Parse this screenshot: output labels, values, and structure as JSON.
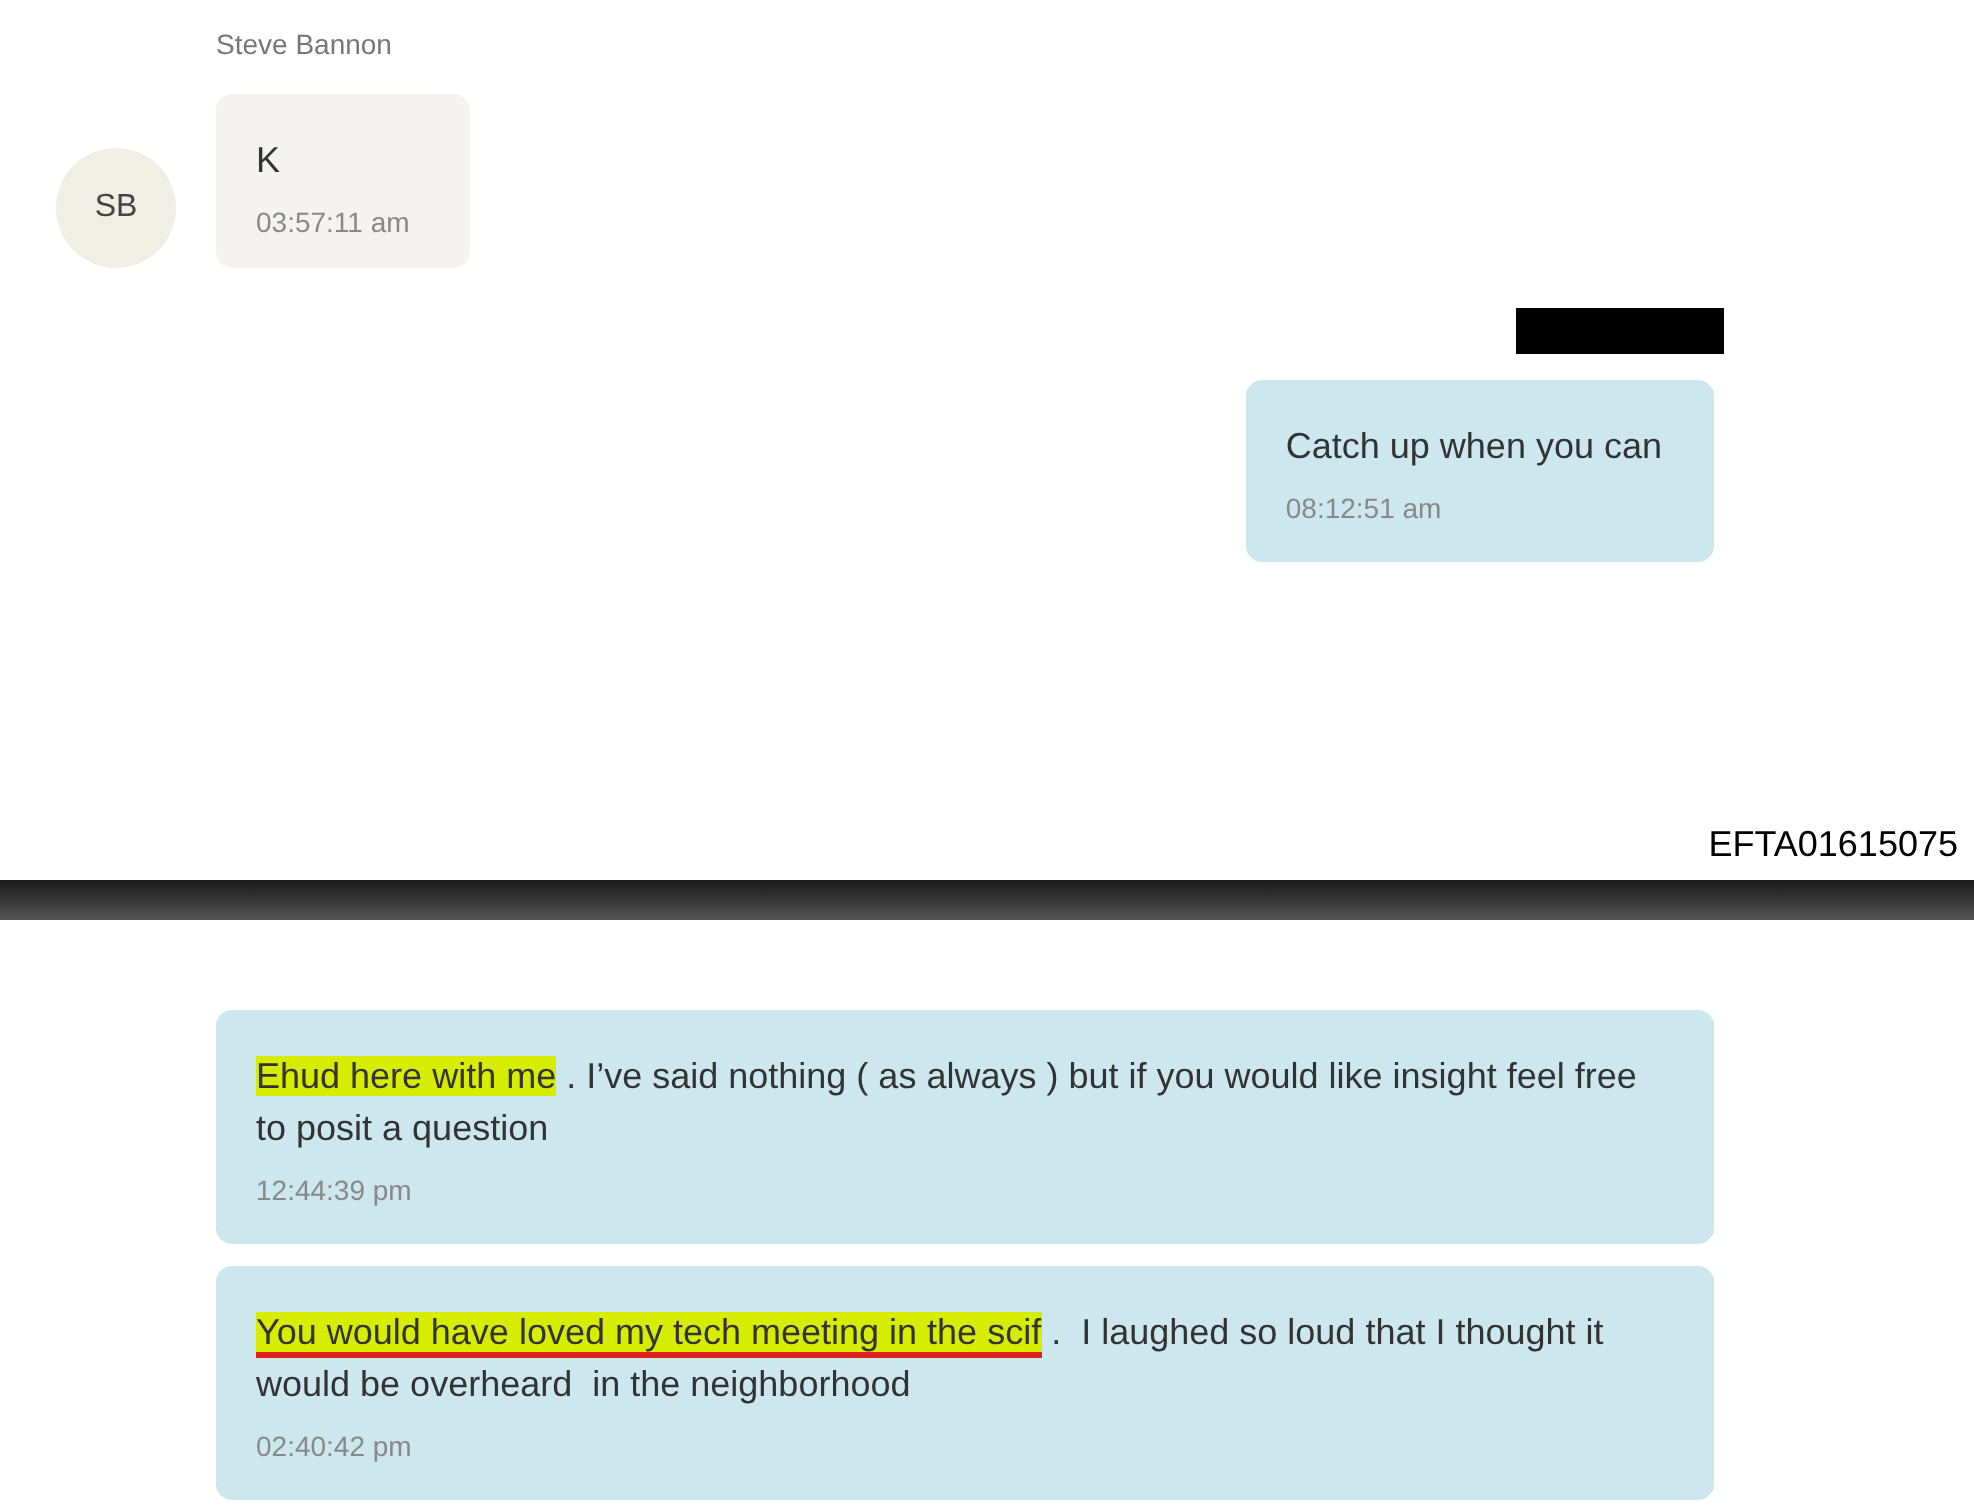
{
  "pages": [
    {
      "messages": [
        {
          "kind": "incoming",
          "sender": "Steve Bannon",
          "avatar": "SB",
          "segments": [
            {
              "text": "K",
              "highlighted": false,
              "underlined": false
            }
          ],
          "time": "03:57:11 am"
        },
        {
          "kind": "outgoing",
          "sender_redacted": true,
          "segments": [
            {
              "text": "Catch up when you can",
              "highlighted": false,
              "underlined": false
            }
          ],
          "time": "08:12:51 am"
        }
      ],
      "document_id": "EFTA01615075"
    },
    {
      "messages": [
        {
          "kind": "outgoing",
          "sender_redacted": false,
          "segments": [
            {
              "text": "Ehud here with me",
              "highlighted": true,
              "underlined": false
            },
            {
              "text": " . I’ve said nothing ( as always ) but if you would like insight feel free to posit a question",
              "highlighted": false,
              "underlined": false
            }
          ],
          "time": "12:44:39 pm"
        },
        {
          "kind": "outgoing",
          "sender_redacted": false,
          "segments": [
            {
              "text": "You would have loved my tech meeting in the scif",
              "highlighted": true,
              "underlined": true
            },
            {
              "text": " .  I laughed so loud that I thought it would be overheard  in the neighborhood",
              "highlighted": false,
              "underlined": false
            }
          ],
          "time": "02:40:42 pm"
        }
      ]
    }
  ]
}
